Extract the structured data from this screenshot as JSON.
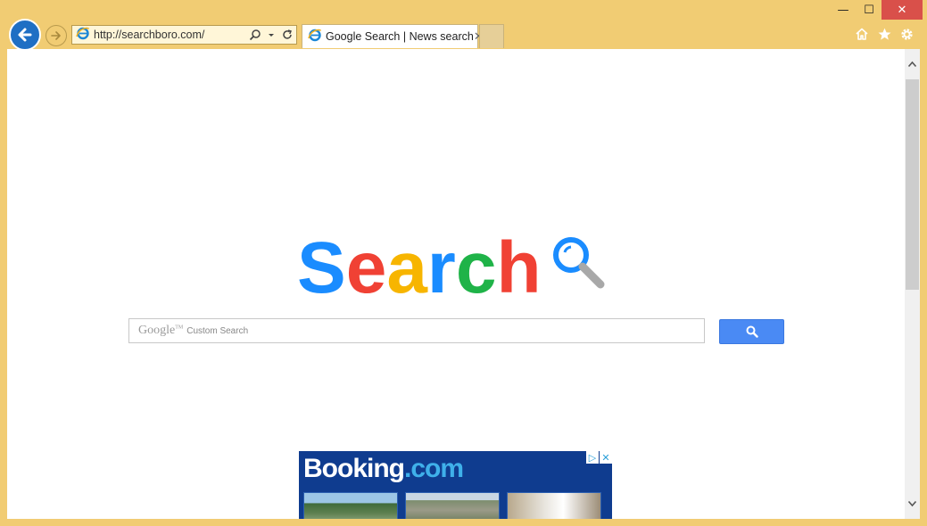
{
  "window": {
    "minimize": "—",
    "maximize": "☐",
    "close": "✕"
  },
  "address_bar": {
    "url": "http://searchboro.com/"
  },
  "tabs": [
    {
      "label": "Google Search | News search",
      "active": true
    }
  ],
  "page": {
    "logo": {
      "letters": [
        "S",
        "e",
        "a",
        "r",
        "c",
        "h"
      ],
      "colors": [
        "#1a8cff",
        "#f04134",
        "#f7b500",
        "#1a8cff",
        "#1fb348",
        "#f04134"
      ]
    },
    "search": {
      "brand": "Google",
      "trademark": "TM",
      "placeholder": "Custom Search"
    },
    "ad": {
      "brand_main": "Booking",
      "brand_dot": ".com",
      "adchoices": "▷",
      "close": "✕"
    }
  },
  "colors": {
    "frame": "#f1cc73",
    "back_button": "#1f6fc4",
    "search_button": "#4a8af4",
    "ad_background": "#0f3c8f"
  }
}
